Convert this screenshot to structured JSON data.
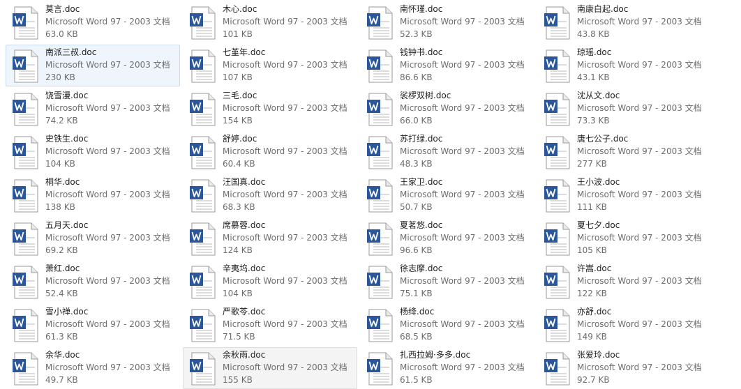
{
  "view": "tiles",
  "file_type": "Microsoft Word 97 - 2003 文档",
  "icon": "word-doc-icon",
  "colors": {
    "selected_background": "#eef5fc",
    "selected_border": "#c9def5",
    "hover_background": "#f4f4f4",
    "word_blue": "#2b579a"
  },
  "files": [
    {
      "name": "莫言.doc",
      "size": "63.0 KB"
    },
    {
      "name": "木心.doc",
      "size": "101 KB"
    },
    {
      "name": "南怀瑾.doc",
      "size": "52.3 KB"
    },
    {
      "name": "南康白起.doc",
      "size": "43.8 KB"
    },
    {
      "name": "南派三叔.doc",
      "size": "230 KB",
      "state": "selected"
    },
    {
      "name": "七堇年.doc",
      "size": "107 KB"
    },
    {
      "name": "钱钟书.doc",
      "size": "86.6 KB"
    },
    {
      "name": "琼瑶.doc",
      "size": "43.1 KB"
    },
    {
      "name": "饶雪漫.doc",
      "size": "74.2 KB"
    },
    {
      "name": "三毛.doc",
      "size": "154 KB"
    },
    {
      "name": "裟椤双树.doc",
      "size": "66.0 KB"
    },
    {
      "name": "沈从文.doc",
      "size": "73.3 KB"
    },
    {
      "name": "史铁生.doc",
      "size": "104 KB"
    },
    {
      "name": "舒婷.doc",
      "size": "60.4 KB"
    },
    {
      "name": "苏打绿.doc",
      "size": "48.3 KB"
    },
    {
      "name": "唐七公子.doc",
      "size": "277 KB"
    },
    {
      "name": "桐华.doc",
      "size": "138 KB"
    },
    {
      "name": "汪国真.doc",
      "size": "68.3 KB"
    },
    {
      "name": "王家卫.doc",
      "size": "50.7 KB"
    },
    {
      "name": "王小波.doc",
      "size": "111 KB"
    },
    {
      "name": "五月天.doc",
      "size": "69.2 KB"
    },
    {
      "name": "席慕蓉.doc",
      "size": "124 KB"
    },
    {
      "name": "夏茗悠.doc",
      "size": "96.6 KB"
    },
    {
      "name": "夏七夕.doc",
      "size": "105 KB"
    },
    {
      "name": "萧红.doc",
      "size": "52.4 KB"
    },
    {
      "name": "辛夷坞.doc",
      "size": "104 KB"
    },
    {
      "name": "徐志摩.doc",
      "size": "75.1 KB"
    },
    {
      "name": "许嵩.doc",
      "size": "122 KB"
    },
    {
      "name": "雪小禅.doc",
      "size": "61.3 KB"
    },
    {
      "name": "严歌苓.doc",
      "size": "71.5 KB"
    },
    {
      "name": "杨绛.doc",
      "size": "68.5 KB"
    },
    {
      "name": "亦舒.doc",
      "size": "149 KB"
    },
    {
      "name": "余华.doc",
      "size": "49.7 KB"
    },
    {
      "name": "余秋雨.doc",
      "size": "155 KB",
      "state": "hover"
    },
    {
      "name": "扎西拉姆·多多.doc",
      "size": "61.5 KB"
    },
    {
      "name": "张爱玲.doc",
      "size": "92.7 KB"
    }
  ]
}
